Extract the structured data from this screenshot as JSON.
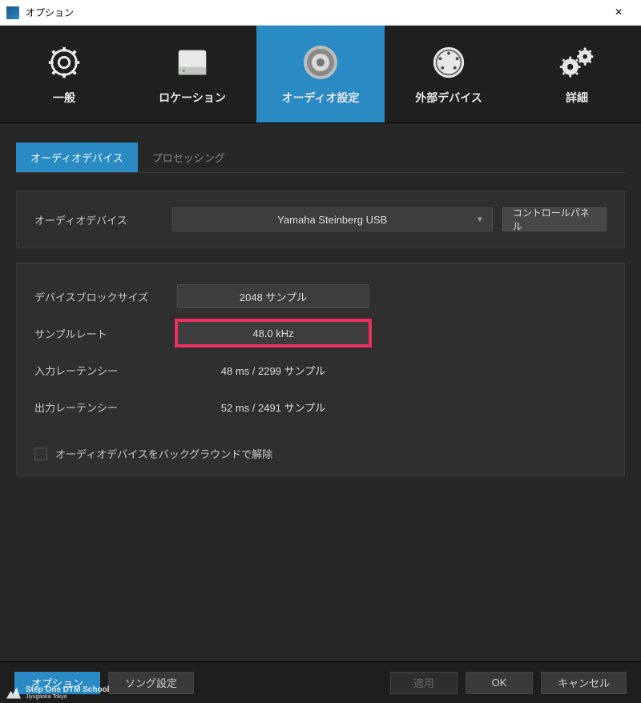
{
  "window": {
    "title": "オプション"
  },
  "categories": [
    {
      "label": "一般"
    },
    {
      "label": "ロケーション"
    },
    {
      "label": "オーディオ設定"
    },
    {
      "label": "外部デバイス"
    },
    {
      "label": "詳細"
    }
  ],
  "subtabs": {
    "audio_device": "オーディオデバイス",
    "processing": "プロセッシング"
  },
  "device_panel": {
    "label": "オーディオデバイス",
    "selected": "Yamaha Steinberg USB",
    "control_panel_button": "コントロールパネル"
  },
  "settings": {
    "block_size_label": "デバイスブロックサイズ",
    "block_size_value": "2048 サンプル",
    "sample_rate_label": "サンプルレート",
    "sample_rate_value": "48.0 kHz",
    "input_latency_label": "入力レーテンシー",
    "input_latency_value": "48 ms / 2299 サンプル",
    "output_latency_label": "出力レーテンシー",
    "output_latency_value": "52 ms / 2491 サンプル",
    "release_bg_label": "オーディオデバイスをバックグラウンドで解除"
  },
  "footer": {
    "options": "オプション",
    "song_settings": "ソング設定",
    "apply": "適用",
    "ok": "OK",
    "cancel": "キャンセル"
  },
  "branding": {
    "line1": "Step One DTM School",
    "line2": "Jiyugaoka Tokyo"
  }
}
